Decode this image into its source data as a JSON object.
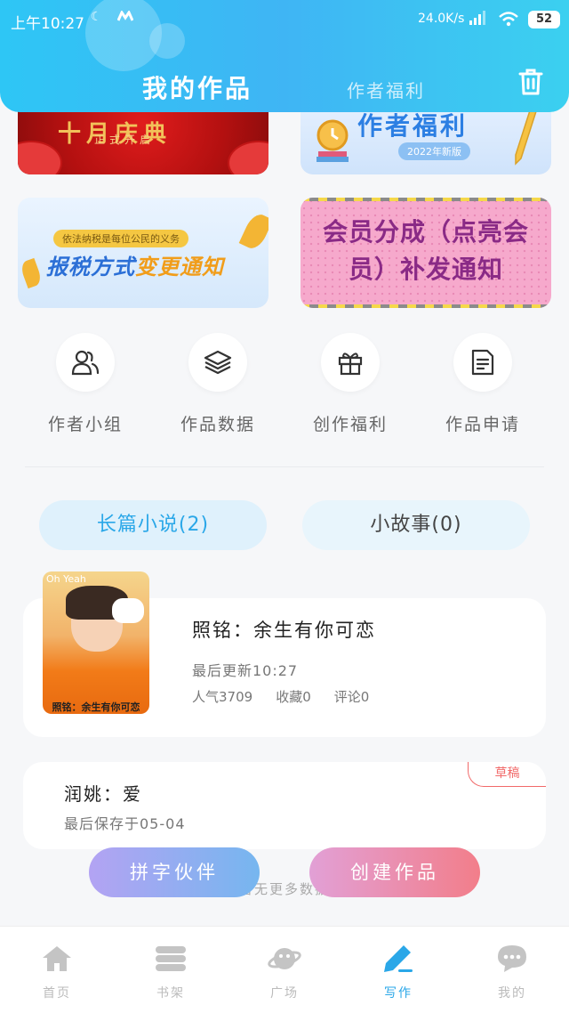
{
  "status_bar": {
    "time": "上午10:27",
    "network_speed": "24.0K/s",
    "battery": "52"
  },
  "header": {
    "tab_my_works": "我的作品",
    "tab_author_welfare": "作者福利"
  },
  "banners": [
    {
      "title": "十月庆典",
      "subtitle": "正式开启"
    },
    {
      "title": "作者福利",
      "chip": "2022年新版"
    },
    {
      "pill": "依法纳税是每位公民的义务",
      "title_part1": "报税方式",
      "title_part2": "变更通知"
    },
    {
      "title": "会员分成（点亮会员）补发通知"
    }
  ],
  "entries": [
    {
      "label": "作者小组",
      "icon": "group-icon"
    },
    {
      "label": "作品数据",
      "icon": "layers-icon"
    },
    {
      "label": "创作福利",
      "icon": "gift-icon"
    },
    {
      "label": "作品申请",
      "icon": "document-icon"
    }
  ],
  "categories": {
    "novel": "长篇小说(2)",
    "story": "小故事(0)"
  },
  "works": [
    {
      "title": "照铭：余生有你可恋",
      "updated": "最后更新10:27",
      "popularity": "人气3709",
      "favorites": "收藏0",
      "comments": "评论0",
      "cover_caption": "照铭：余生有你可恋",
      "cover_label": "Oh Yeah"
    },
    {
      "badge": "草稿",
      "title": "润姚：爱",
      "saved": "最后保存于05-04"
    }
  ],
  "no_more": "暂无更多数据",
  "buttons": {
    "partner": "拼字伙伴",
    "create": "创建作品"
  },
  "bottom_nav": [
    {
      "label": "首页",
      "icon": "home-icon"
    },
    {
      "label": "书架",
      "icon": "bookshelf-icon"
    },
    {
      "label": "广场",
      "icon": "planet-icon"
    },
    {
      "label": "写作",
      "icon": "pen-icon",
      "active": true
    },
    {
      "label": "我的",
      "icon": "chat-bubble-icon"
    }
  ],
  "colors": {
    "header_start": "#2ec6f5",
    "header_end": "#3bd0f0",
    "accent": "#2aa7e8",
    "draft": "#f16a6a"
  }
}
